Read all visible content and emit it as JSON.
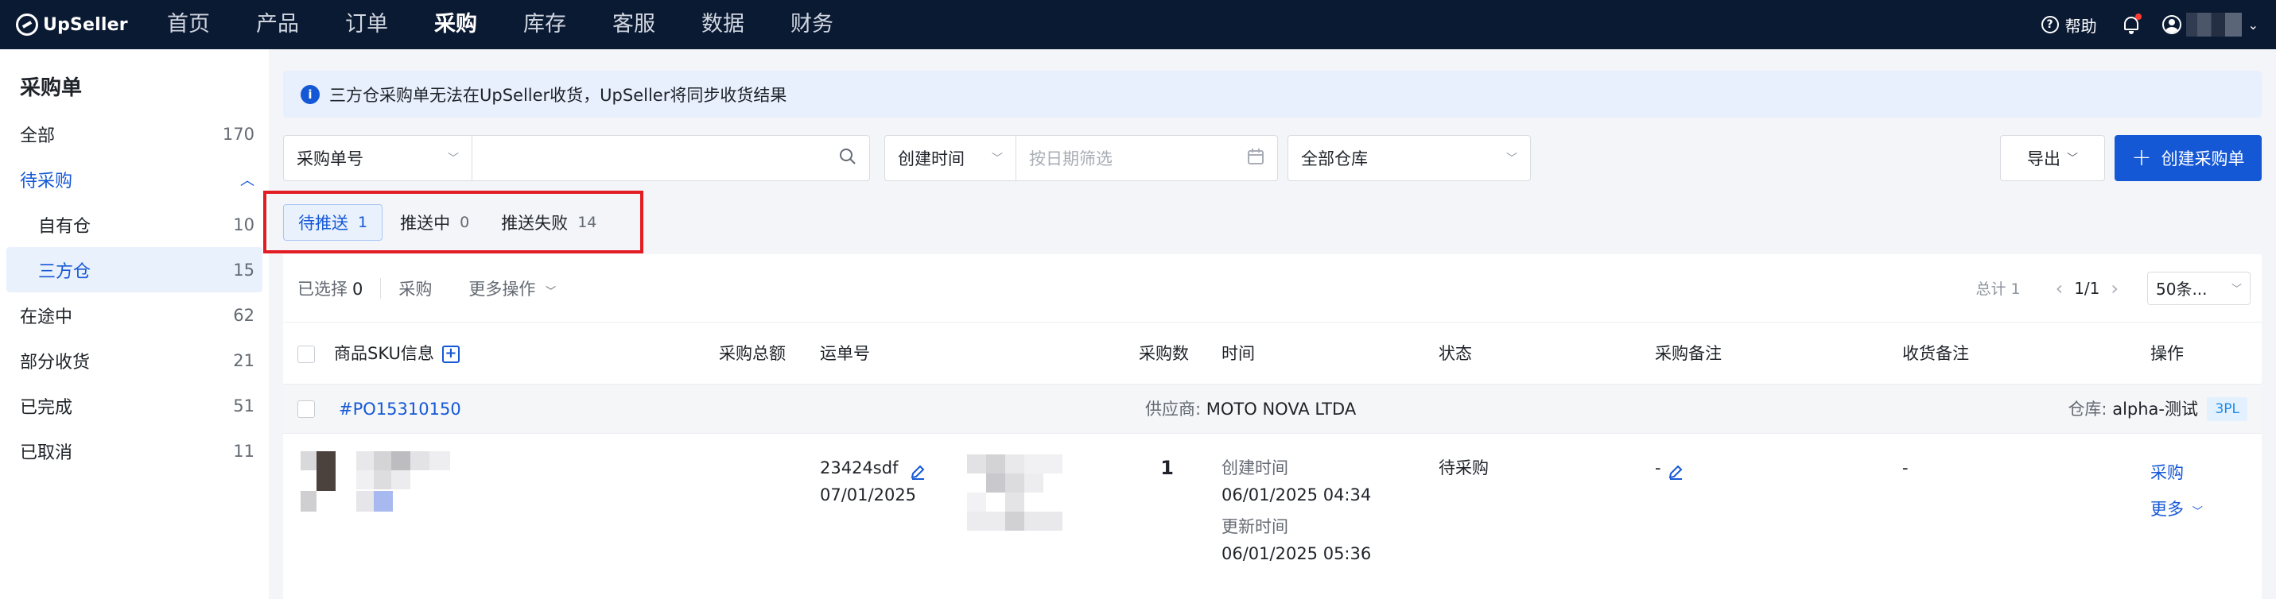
{
  "topnav": {
    "brand": "UpSeller",
    "menu": [
      "首页",
      "产品",
      "订单",
      "采购",
      "库存",
      "客服",
      "数据",
      "财务"
    ],
    "active_menu": "采购",
    "help": "帮助"
  },
  "sidebar": {
    "title": "采购单",
    "items": [
      {
        "label": "全部",
        "count": "170"
      },
      {
        "label": "待采购",
        "count": ""
      },
      {
        "label": "自有仓",
        "count": "10"
      },
      {
        "label": "三方仓",
        "count": "15"
      },
      {
        "label": "在途中",
        "count": "62"
      },
      {
        "label": "部分收货",
        "count": "21"
      },
      {
        "label": "已完成",
        "count": "51"
      },
      {
        "label": "已取消",
        "count": "11"
      }
    ]
  },
  "notice": {
    "text": "三方仓采购单无法在UpSeller收货，UpSeller将同步收货结果"
  },
  "filters": {
    "search_type": "采购单号",
    "time_type": "创建时间",
    "date_placeholder": "按日期筛选",
    "warehouse": "全部仓库",
    "export_label": "导出",
    "create_label": "创建采购单"
  },
  "subtabs": [
    {
      "label": "待推送",
      "count": "1"
    },
    {
      "label": "推送中",
      "count": "0"
    },
    {
      "label": "推送失败",
      "count": "14"
    }
  ],
  "toolbar": {
    "selected_label": "已选择",
    "selected_count": "0",
    "purchase": "采购",
    "more_ops": "更多操作",
    "total": "总计 1",
    "page": "1/1",
    "page_size": "50条..."
  },
  "table": {
    "headers": {
      "sku": "商品SKU信息",
      "amount": "采购总额",
      "tracking": "运单号",
      "qty": "采购数",
      "time": "时间",
      "status": "状态",
      "purchase_note": "采购备注",
      "receive_note": "收货备注",
      "action": "操作"
    },
    "group": {
      "po": "#PO15310150",
      "supplier_label": "供应商:",
      "supplier": "MOTO NOVA LTDA",
      "warehouse_label": "仓库:",
      "warehouse": "alpha-测试",
      "tag": "3PL"
    },
    "row": {
      "tracking_no": "23424sdf",
      "tracking_date": "07/01/2025",
      "qty": "1",
      "created_label": "创建时间",
      "created": "06/01/2025 04:34",
      "updated_label": "更新时间",
      "updated": "06/01/2025 05:36",
      "status": "待采购",
      "purchase_note": "-",
      "receive_note": "-",
      "action_purchase": "采购",
      "action_more": "更多"
    }
  }
}
